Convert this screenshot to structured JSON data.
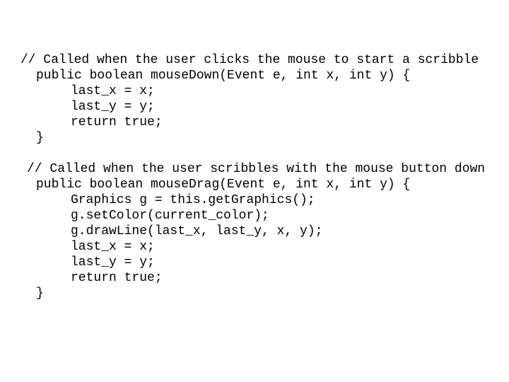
{
  "slide": {
    "background_color": "#ffffff",
    "text_color": "#000000",
    "blocks": [
      {
        "name": "mousedown-handler",
        "lines": [
          {
            "indent": "comment-a",
            "text": "// Called when the user clicks the mouse to start a scribble"
          },
          {
            "indent": "sig",
            "text": "public boolean mouseDown(Event e, int x, int y) {"
          },
          {
            "indent": "stmt",
            "text": "last_x = x;"
          },
          {
            "indent": "stmt",
            "text": "last_y = y;"
          },
          {
            "indent": "stmt",
            "text": "return true;"
          },
          {
            "indent": "brace",
            "text": "}"
          }
        ]
      },
      {
        "name": "mousedrag-handler",
        "lines": [
          {
            "indent": "comment-b",
            "text": "// Called when the user scribbles with the mouse button down"
          },
          {
            "indent": "sig",
            "text": "public boolean mouseDrag(Event e, int x, int y) {"
          },
          {
            "indent": "stmt",
            "text": "Graphics g = this.getGraphics();"
          },
          {
            "indent": "stmt",
            "text": "g.setColor(current_color);"
          },
          {
            "indent": "stmt",
            "text": "g.drawLine(last_x, last_y, x, y);"
          },
          {
            "indent": "stmt",
            "text": "last_x = x;"
          },
          {
            "indent": "stmt",
            "text": "last_y = y;"
          },
          {
            "indent": "stmt",
            "text": "return true;"
          },
          {
            "indent": "brace",
            "text": "}"
          }
        ]
      }
    ]
  }
}
